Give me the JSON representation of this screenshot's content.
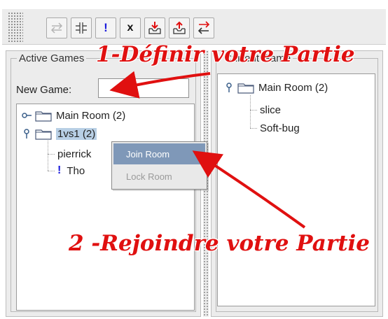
{
  "toolbar": {
    "buttons": [
      {
        "name": "swap-arrows-disabled-icon"
      },
      {
        "name": "split-icon"
      },
      {
        "name": "exclamation-icon",
        "label": "!"
      },
      {
        "name": "close-x-icon",
        "label": "x"
      },
      {
        "name": "download-tray-icon"
      },
      {
        "name": "upload-tray-icon"
      },
      {
        "name": "exchange-arrows-icon"
      }
    ]
  },
  "left_panel": {
    "title": "Active Games",
    "new_game_label": "New Game:",
    "new_game_value": "",
    "tree": [
      {
        "label": "Main Room (2)",
        "expanded": false
      },
      {
        "label": "1vs1 (2)",
        "expanded": true,
        "selected": true,
        "children": [
          {
            "label": "pierrick"
          },
          {
            "label": "Tho",
            "marker": "!"
          }
        ]
      }
    ]
  },
  "right_panel": {
    "title": "Current Game",
    "tree": [
      {
        "label": "Main Room (2)",
        "expanded": true,
        "children": [
          {
            "label": "slice"
          },
          {
            "label": "Soft-bug"
          }
        ]
      }
    ]
  },
  "context_menu": {
    "items": [
      {
        "label": "Join Room",
        "enabled": true,
        "highlighted": true
      },
      {
        "label": "Lock Room",
        "enabled": false
      }
    ]
  },
  "annotations": {
    "step1": "1-Définir votre Partie",
    "step2": "2 -Rejoindre votre Partie",
    "color": "#e01010"
  },
  "colors": {
    "selection": "#b8cfe5",
    "menu_highlight": "#7f98b8",
    "exclamation": "#1a1adc"
  }
}
